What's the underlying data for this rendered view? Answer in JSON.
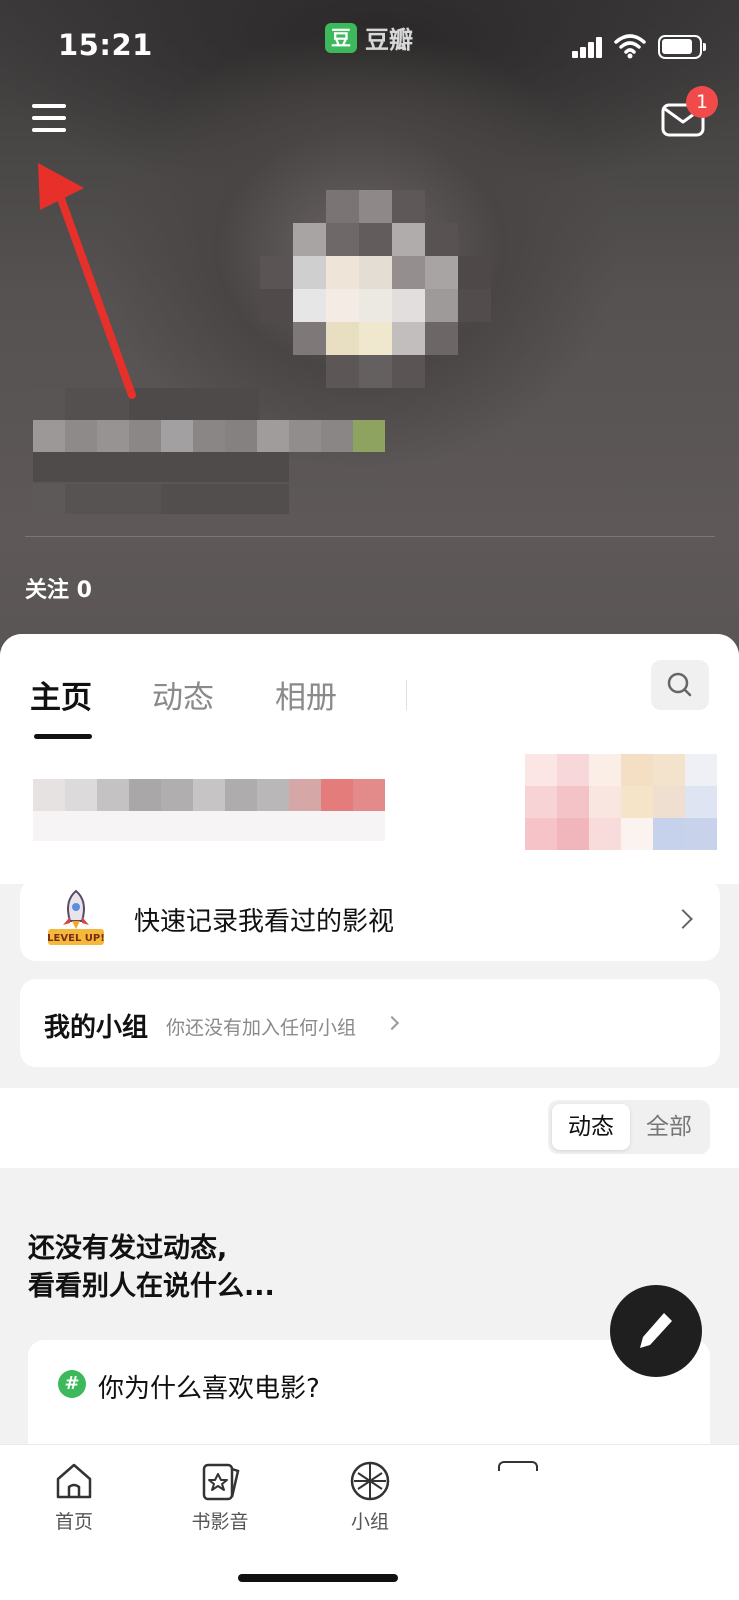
{
  "status_bar": {
    "time": "15:21",
    "app_logo_char": "豆",
    "app_name": "豆瓣",
    "icons": [
      "signal-icon",
      "wifi-icon",
      "battery-icon"
    ]
  },
  "header": {
    "menu_icon": "hamburger-menu-icon",
    "mail_icon": "mail-icon",
    "mail_badge": "1",
    "follow_label": "关注 0"
  },
  "tabs": [
    {
      "label": "主页",
      "active": true
    },
    {
      "label": "动态",
      "active": false
    },
    {
      "label": "相册",
      "active": false
    }
  ],
  "record_card": {
    "badge_text": "LEVEL UP!",
    "label": "快速记录我看过的影视"
  },
  "group_card": {
    "title": "我的小组",
    "subtitle": "你还没有加入任何小组"
  },
  "filter": {
    "options": [
      "动态",
      "全部"
    ],
    "selected": "动态"
  },
  "empty_state": {
    "line1": "还没有发过动态,",
    "line2": "看看别人在说什么..."
  },
  "topic": {
    "hash": "#",
    "text": "你为什么喜欢电影?"
  },
  "bottom_nav": [
    {
      "label": "首页",
      "icon": "home-icon"
    },
    {
      "label": "书影音",
      "icon": "star-card-icon"
    },
    {
      "label": "小组",
      "icon": "globe-icon"
    }
  ],
  "colors": {
    "brand_green": "#3cb95b",
    "badge_red": "#f04a4a",
    "annotation_arrow": "#e8302b"
  }
}
